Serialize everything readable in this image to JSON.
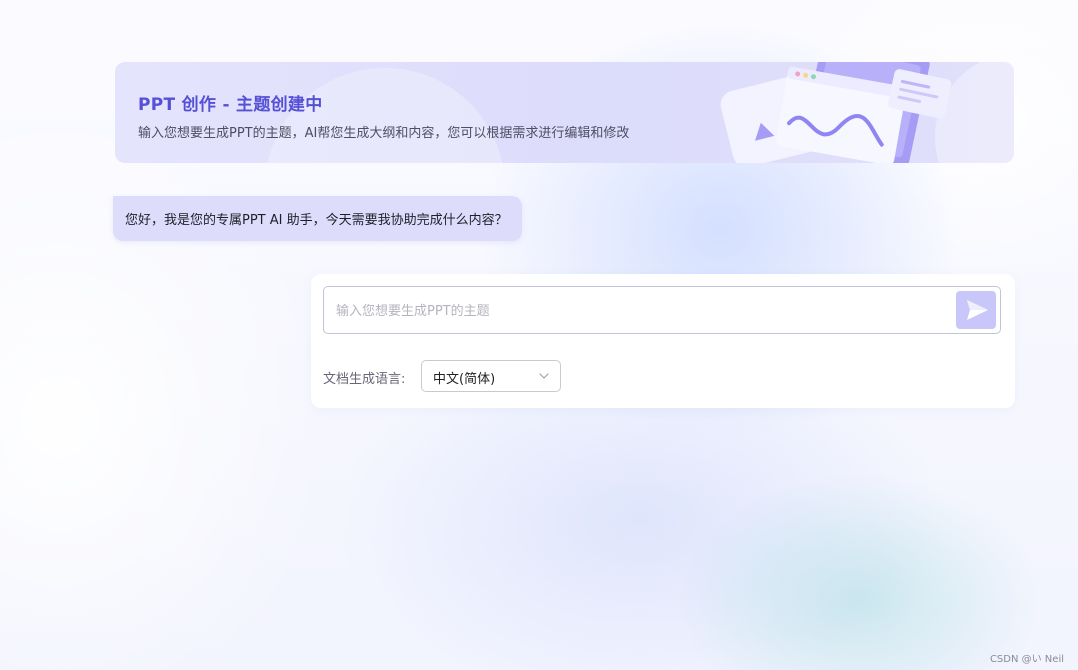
{
  "banner": {
    "title": "PPT 创作 - 主题创建中",
    "subtitle": "输入您想要生成PPT的主题，AI帮您生成大纲和内容，您可以根据需求进行编辑和修改"
  },
  "chat": {
    "assistant_message": "您好，我是您的专属PPT AI 助手，今天需要我协助完成什么内容？"
  },
  "input_card": {
    "topic_placeholder": "输入您想要生成PPT的主题",
    "topic_value": "",
    "language_label": "文档生成语言:",
    "language_value": "中文(简体)"
  },
  "watermark": "CSDN @い Neil",
  "colors": {
    "accent": "#5550d6",
    "banner_bg": "#dcdcfb",
    "bubble_bg": "#dddcfb",
    "send_button": "#c9c6fa"
  },
  "icons": {
    "send": "send-icon",
    "dropdown": "chevron-down-icon"
  }
}
